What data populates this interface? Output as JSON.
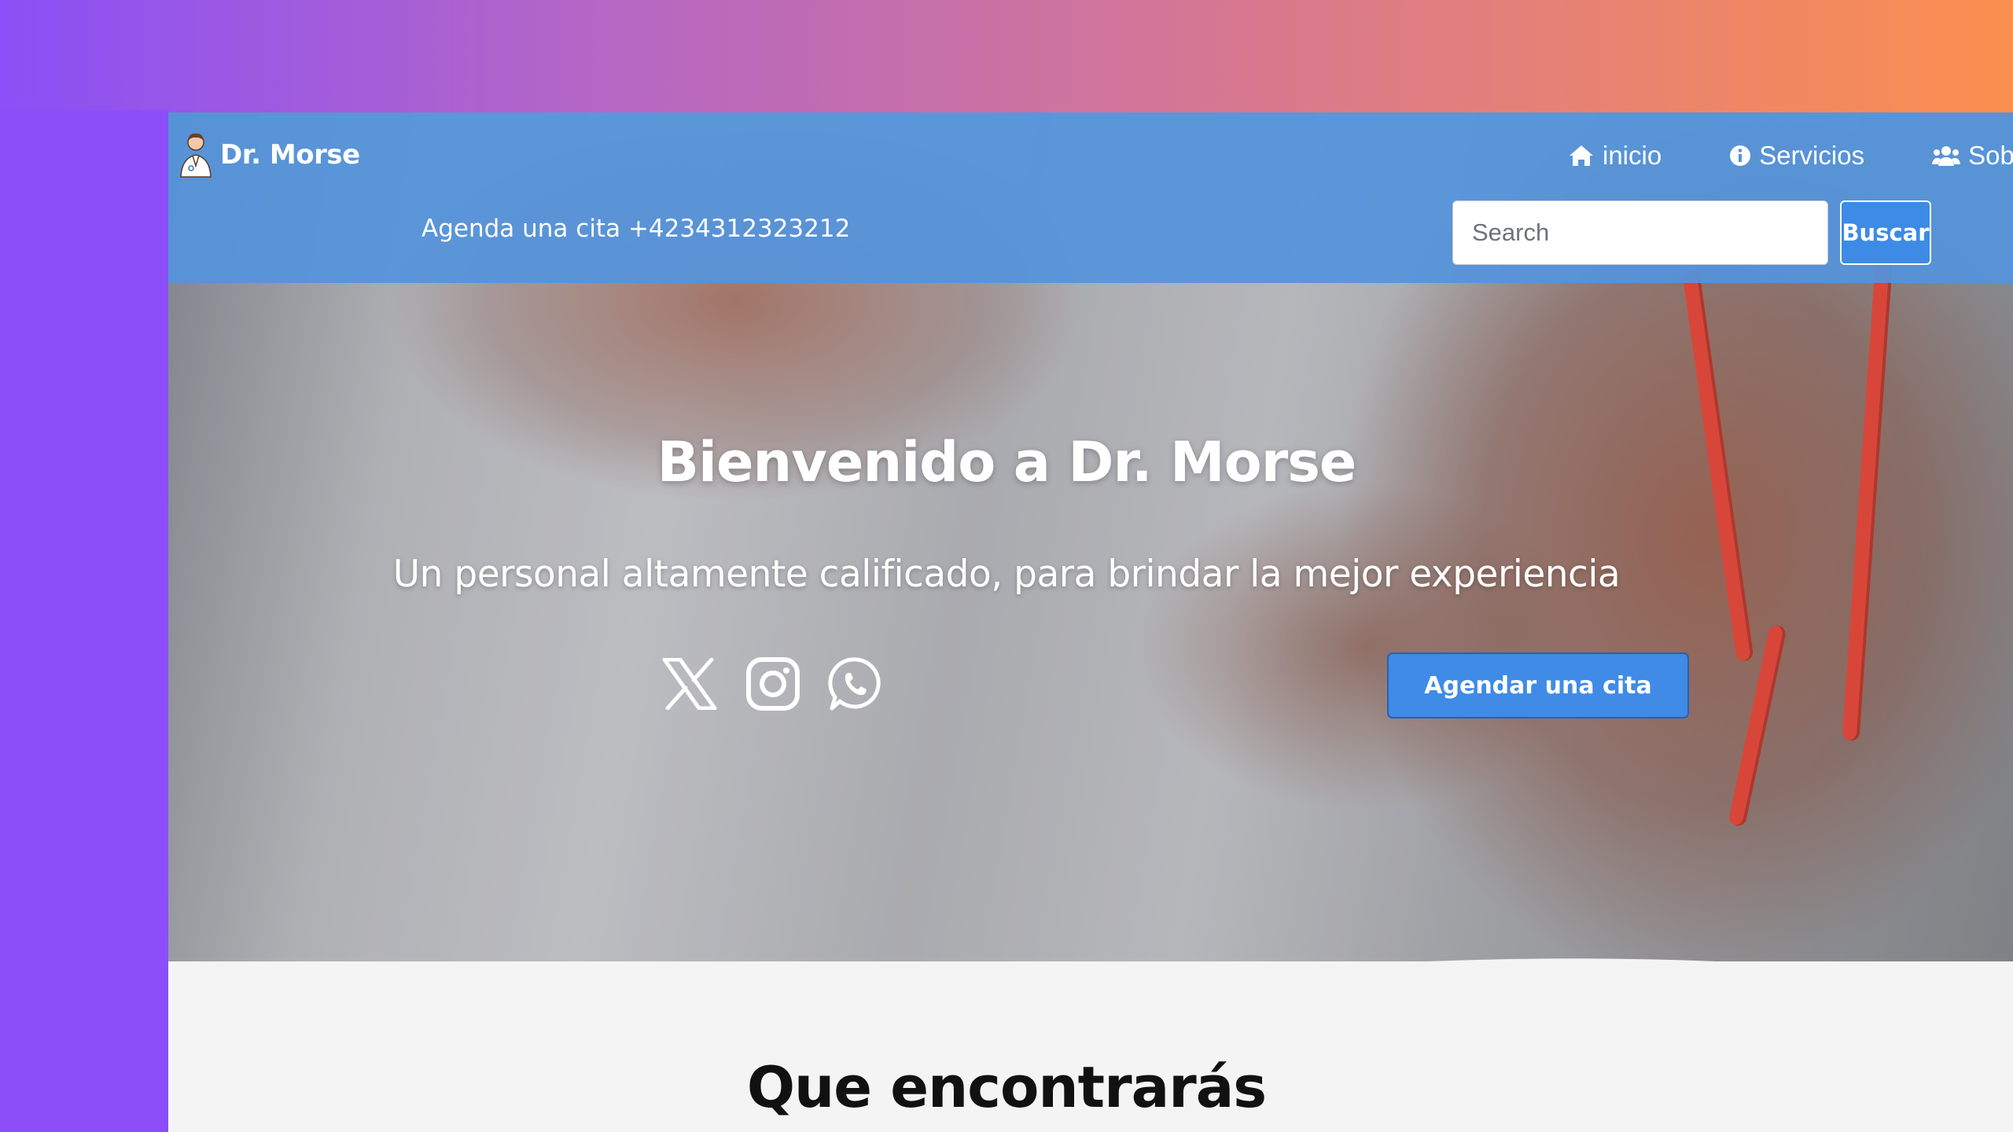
{
  "brand": {
    "name": "Dr. Morse",
    "logo_icon": "doctor-avatar-icon"
  },
  "nav": {
    "items": [
      {
        "label": "inicio",
        "icon": "home-icon"
      },
      {
        "label": "Servicios",
        "icon": "info-circle-icon"
      },
      {
        "label": "Sob",
        "icon": "users-icon"
      }
    ]
  },
  "header": {
    "phone_text": "Agenda una cita +4234312323212",
    "search": {
      "placeholder": "Search",
      "value": ""
    },
    "search_button_label": "Buscar"
  },
  "hero": {
    "title": "Bienvenido a Dr. Morse",
    "subtitle": "Un personal altamente calificado, para brindar la mejor experiencia",
    "social_icons": [
      "x-icon",
      "instagram-icon",
      "whatsapp-icon"
    ],
    "cta_label": "Agendar una cita"
  },
  "section": {
    "title": "Que encontrarás"
  },
  "colors": {
    "header": "#5494dc",
    "accent_button": "#3f8be6",
    "page_background": "#f4f4f4",
    "gradient_left": "#8b50f6",
    "gradient_right": "#fb8f4f"
  }
}
